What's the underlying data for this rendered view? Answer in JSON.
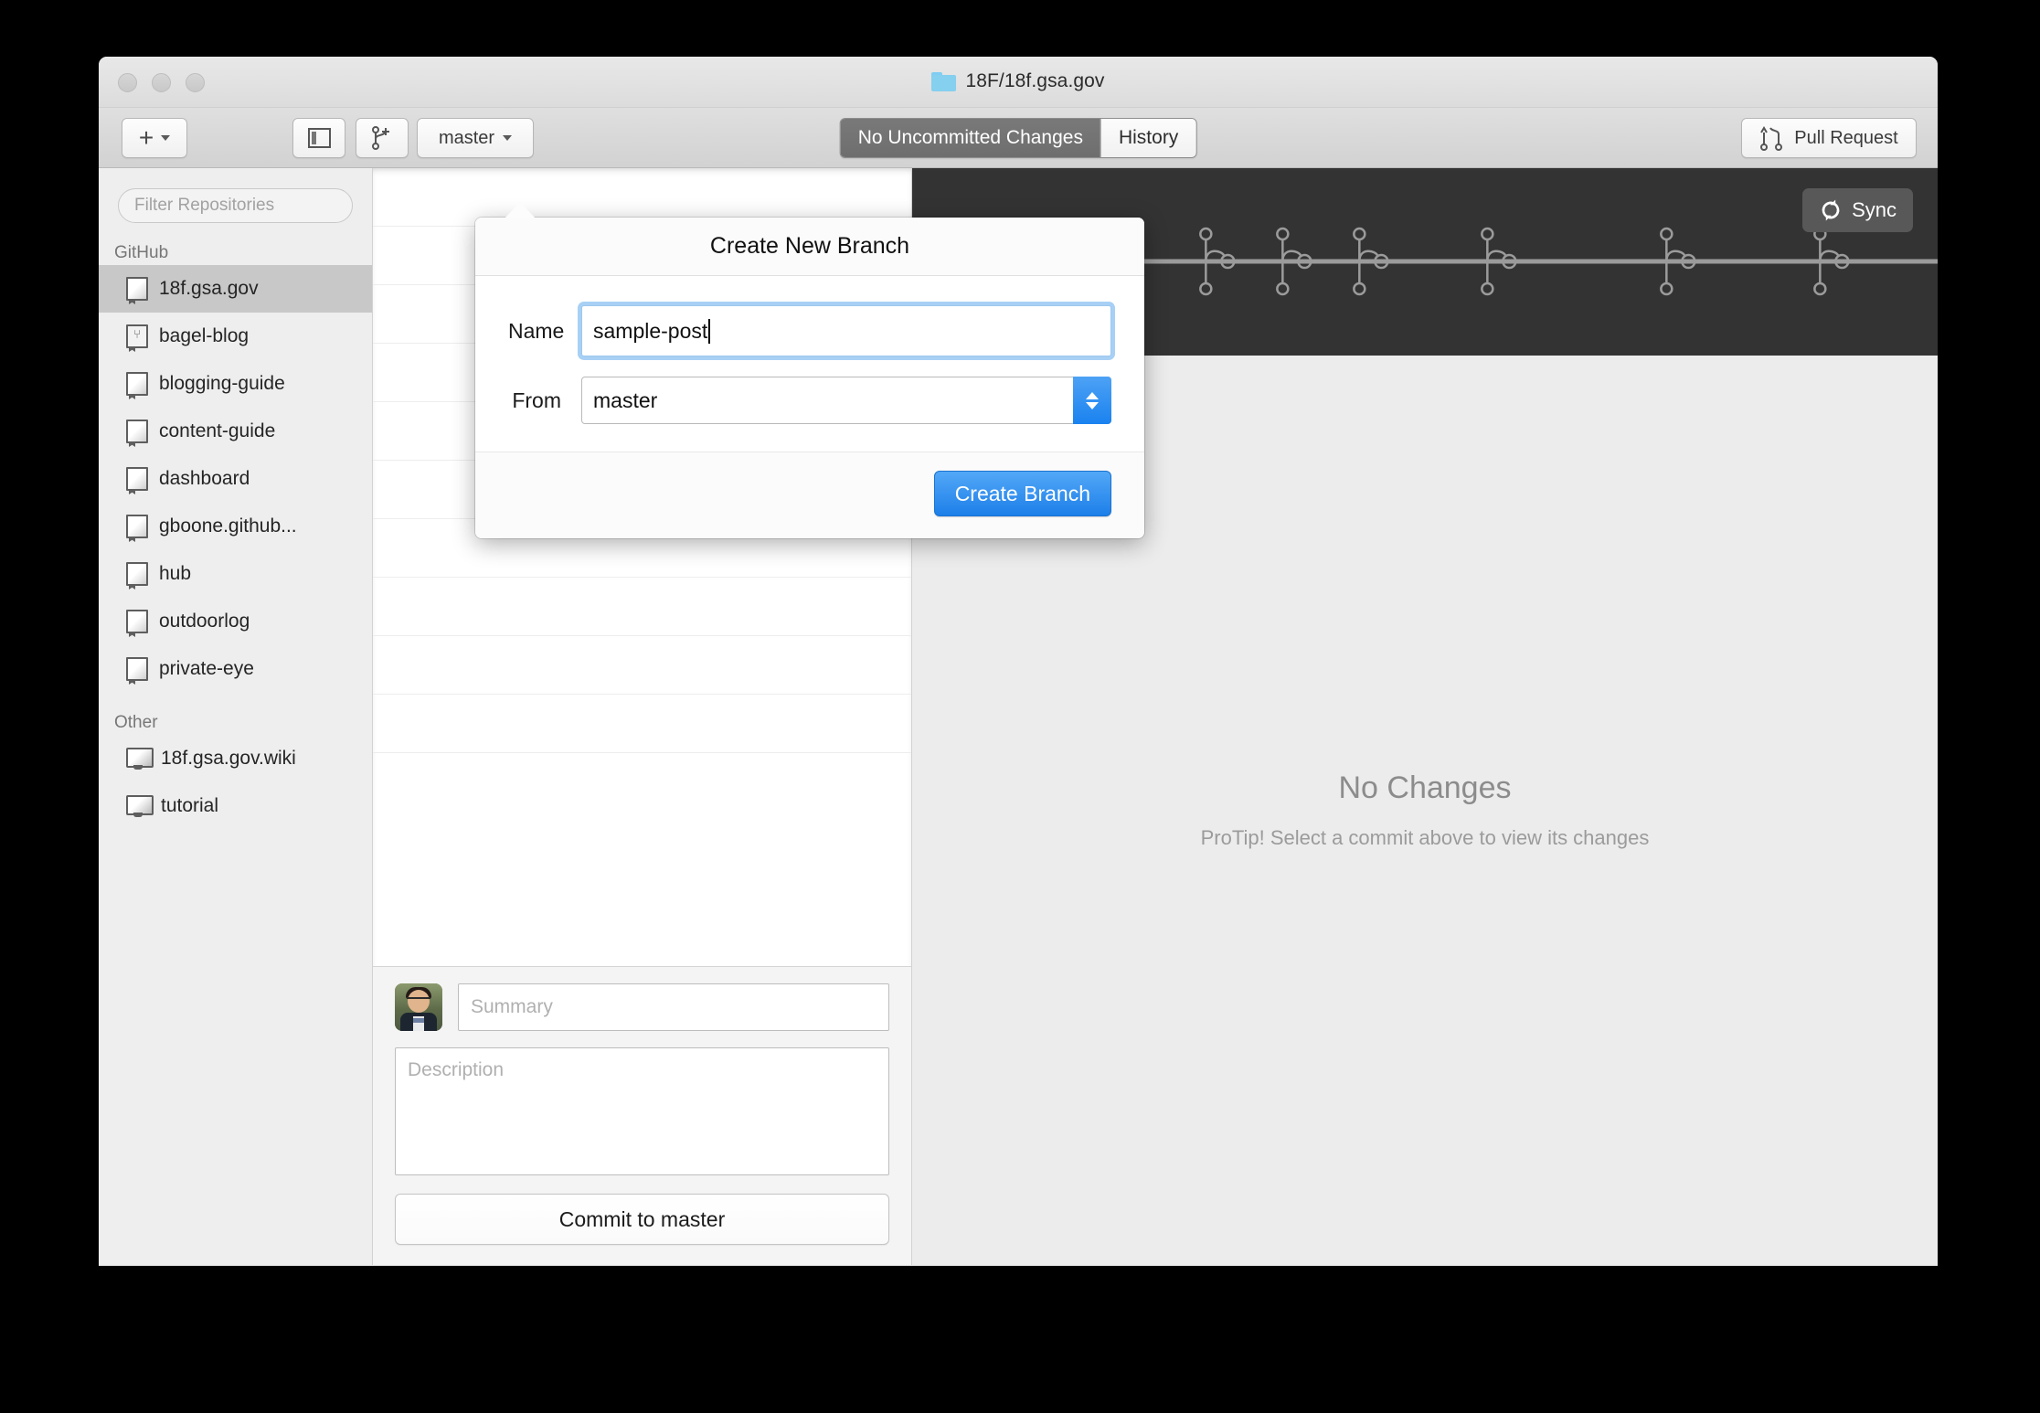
{
  "window": {
    "title": "18F/18f.gsa.gov",
    "folder_icon": "folder-icon"
  },
  "toolbar": {
    "add_label": "+",
    "add_icon": "plus-icon",
    "sidebar_icon": "sidebar-toggle-icon",
    "branch_icon": "create-branch-icon",
    "branch_label": "master",
    "pull_request_label": "Pull Request",
    "pull_request_icon": "pull-request-icon",
    "segments": [
      {
        "label": "No Uncommitted Changes",
        "selected": true
      },
      {
        "label": "History",
        "selected": false
      }
    ]
  },
  "sidebar": {
    "filter_placeholder": "Filter Repositories",
    "groups": [
      {
        "label": "GitHub",
        "items": [
          {
            "label": "18f.gsa.gov",
            "icon": "repo-icon",
            "selected": true
          },
          {
            "label": "bagel-blog",
            "icon": "repo-fork-icon",
            "selected": false
          },
          {
            "label": "blogging-guide",
            "icon": "repo-icon",
            "selected": false
          },
          {
            "label": "content-guide",
            "icon": "repo-icon",
            "selected": false
          },
          {
            "label": "dashboard",
            "icon": "repo-icon",
            "selected": false
          },
          {
            "label": "gboone.github...",
            "icon": "repo-icon",
            "selected": false
          },
          {
            "label": "hub",
            "icon": "repo-icon",
            "selected": false
          },
          {
            "label": "outdoorlog",
            "icon": "repo-icon",
            "selected": false
          },
          {
            "label": "private-eye",
            "icon": "repo-icon",
            "selected": false
          }
        ]
      },
      {
        "label": "Other",
        "items": [
          {
            "label": "18f.gsa.gov.wiki",
            "icon": "local-repo-icon",
            "selected": false
          },
          {
            "label": "tutorial",
            "icon": "local-repo-icon",
            "selected": false
          }
        ]
      }
    ]
  },
  "commit_form": {
    "avatar": "user-avatar",
    "summary_placeholder": "Summary",
    "summary_value": "",
    "description_placeholder": "Description",
    "description_value": "",
    "commit_button_label": "Commit to master"
  },
  "graph": {
    "sync_label": "Sync",
    "sync_icon": "sync-icon",
    "background_color": "#333333",
    "line_color": "#9b9b9b",
    "nodes": [
      2,
      23,
      34,
      43,
      52,
      67,
      88,
      106,
      118
    ]
  },
  "right_panel": {
    "empty_title": "No Changes",
    "empty_subtitle": "ProTip! Select a commit above to view its changes"
  },
  "dialog": {
    "title": "Create New Branch",
    "name_label": "Name",
    "name_value": "sample-post",
    "from_label": "From",
    "from_value": "master",
    "create_label": "Create Branch",
    "accent_color": "#1d7fe9"
  }
}
